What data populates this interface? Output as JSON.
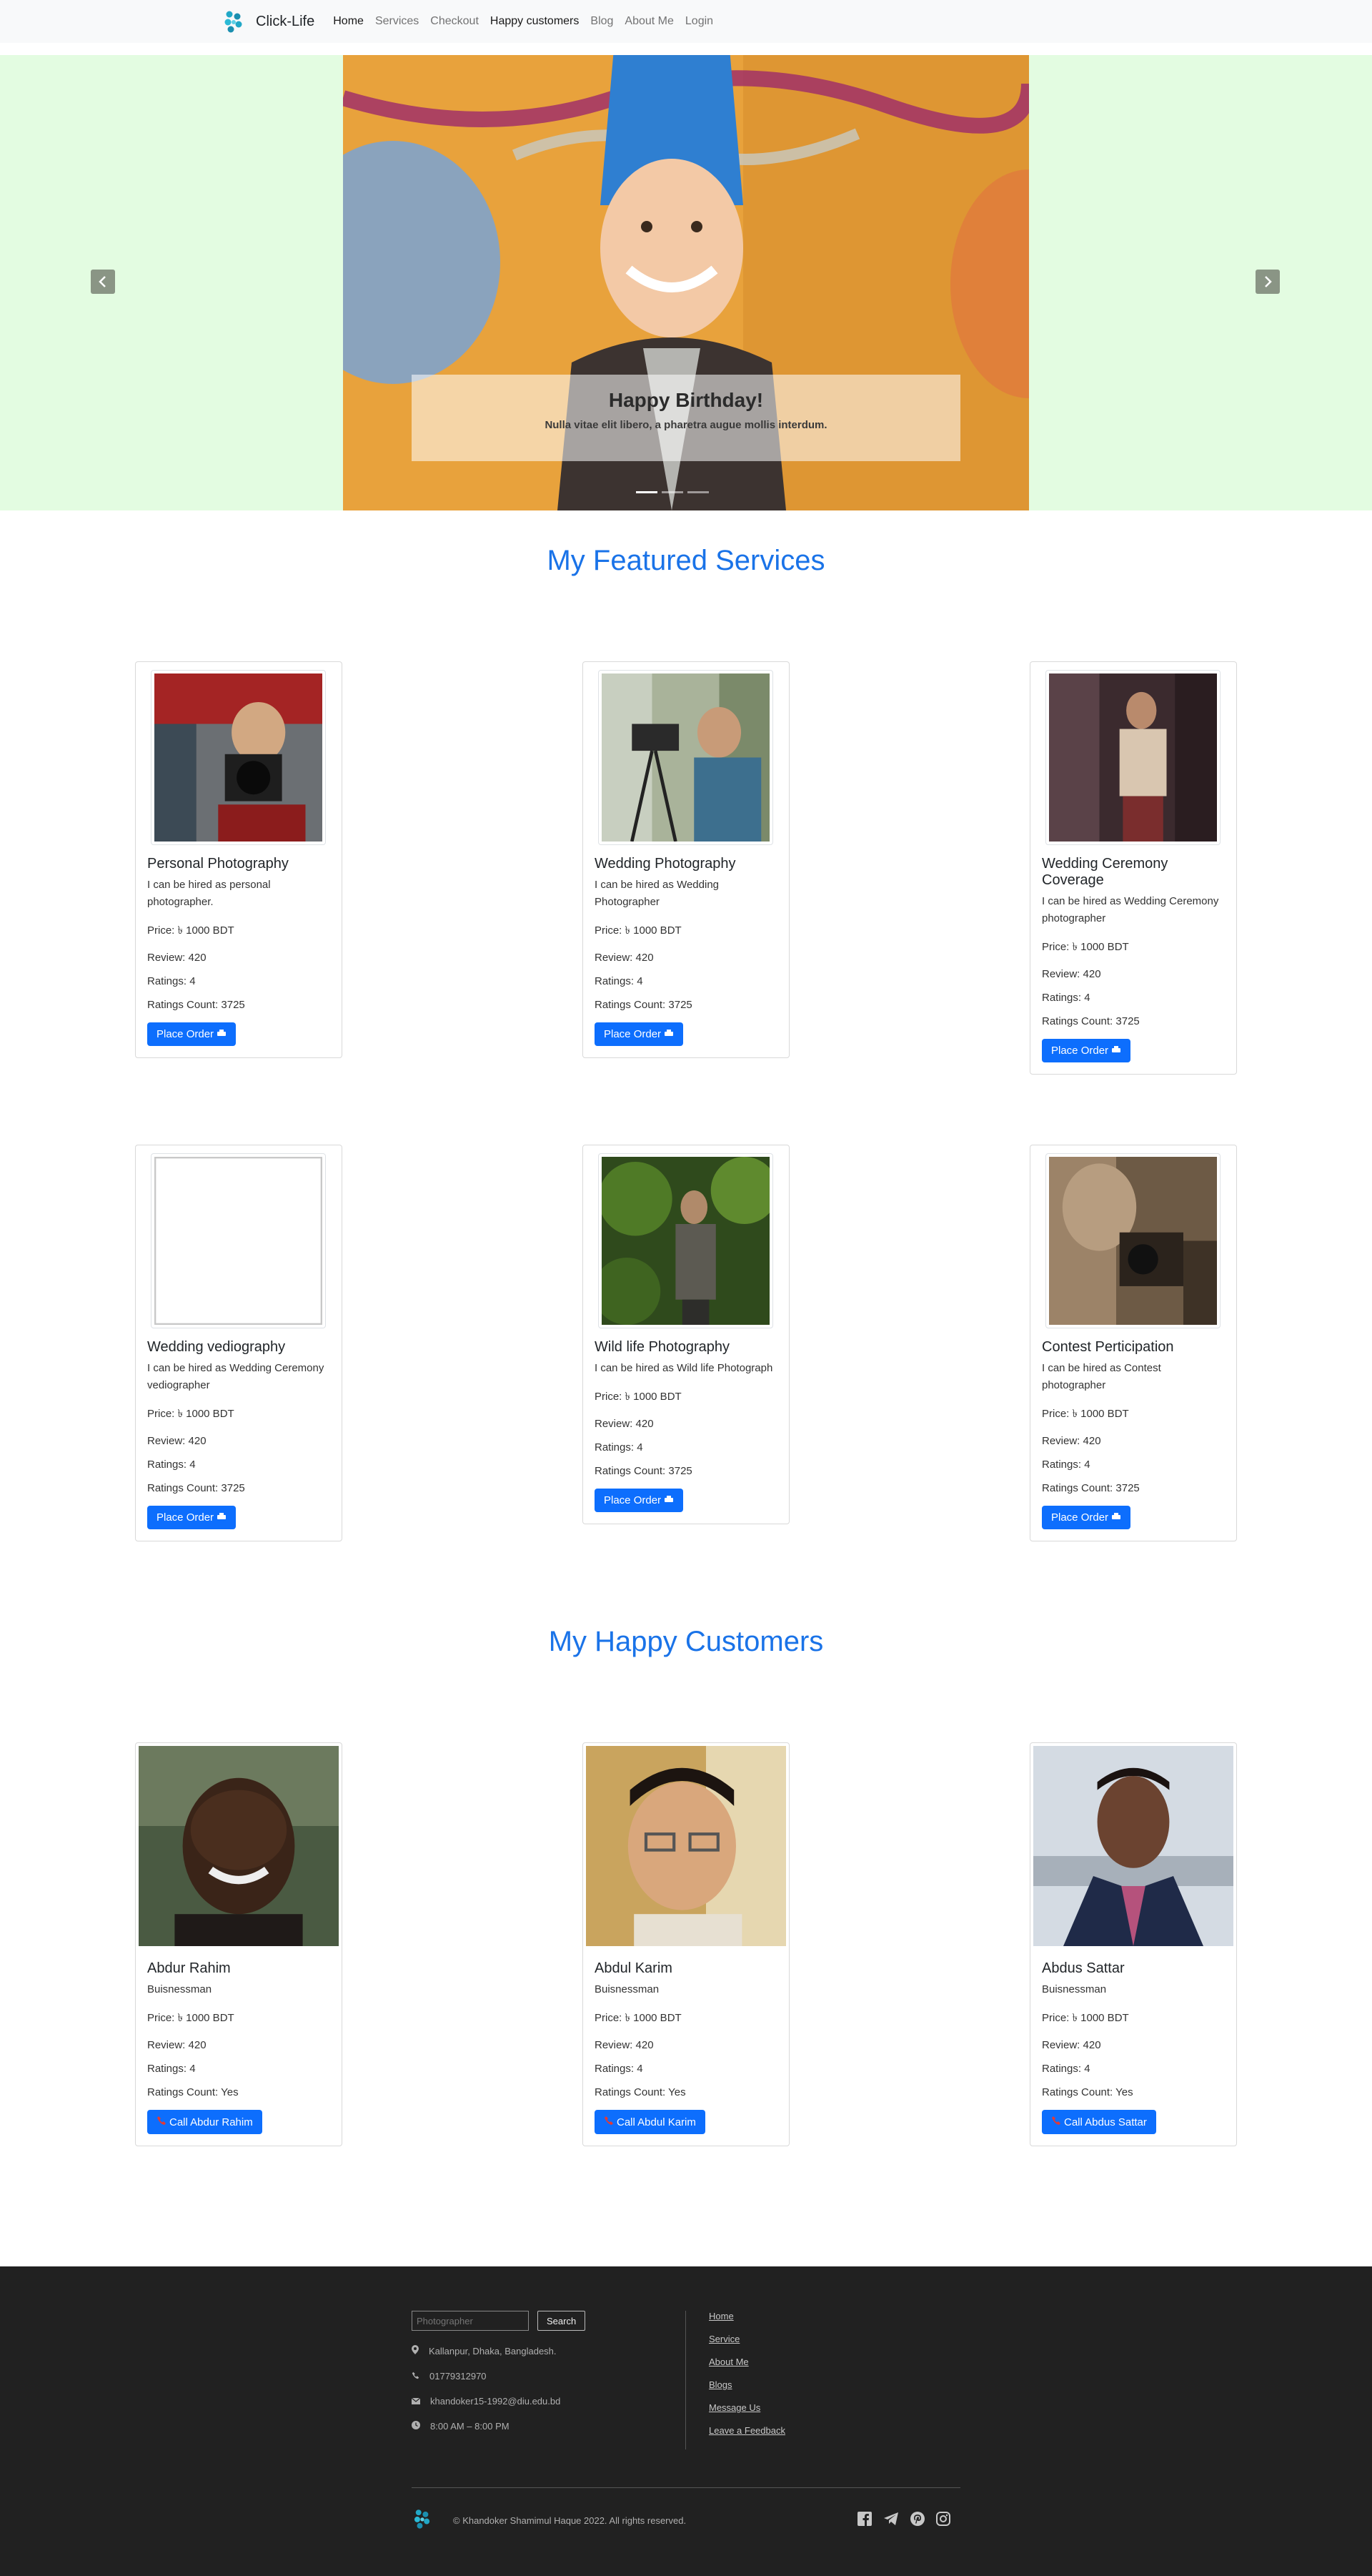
{
  "nav": {
    "brand": "Click-Life",
    "links": [
      "Home",
      "Services",
      "Checkout",
      "Happy customers",
      "Blog",
      "About Me",
      "Login"
    ]
  },
  "hero": {
    "caption_title": "Happy Birthday!",
    "caption_text": "Nulla vitae elit libero, a pharetra augue mollis interdum.",
    "slides": 3,
    "active_slide": 1
  },
  "services": {
    "title": "My Featured Services",
    "button_label": "Place Order",
    "items": [
      {
        "name": "Personal Photography",
        "desc": "I can be hired as personal photographer.",
        "price": "Price: ৳ 1000 BDT",
        "review": "Review: 420",
        "ratings": "Ratings: 4",
        "count": "Ratings Count: 3725"
      },
      {
        "name": "Wedding Photography",
        "desc": "I can be hired as Wedding Photographer",
        "price": "Price: ৳ 1000 BDT",
        "review": "Review: 420",
        "ratings": "Ratings: 4",
        "count": "Ratings Count: 3725"
      },
      {
        "name": "Wedding Ceremony Coverage",
        "desc": "I can be hired as Wedding Ceremony photographer",
        "price": "Price: ৳ 1000 BDT",
        "review": "Review: 420",
        "ratings": "Ratings: 4",
        "count": "Ratings Count: 3725"
      },
      {
        "name": "Wedding vediography",
        "desc": "I can be hired as Wedding Ceremony vediographer",
        "price": "Price: ৳ 1000 BDT",
        "review": "Review: 420",
        "ratings": "Ratings: 4",
        "count": "Ratings Count: 3725"
      },
      {
        "name": "Wild life Photography",
        "desc": "I can be hired as Wild life Photograph",
        "price": "Price: ৳ 1000 BDT",
        "review": "Review: 420",
        "ratings": "Ratings: 4",
        "count": "Ratings Count: 3725"
      },
      {
        "name": "Contest Perticipation",
        "desc": "I can be hired as Contest photographer",
        "price": "Price: ৳ 1000 BDT",
        "review": "Review: 420",
        "ratings": "Ratings: 4",
        "count": "Ratings Count: 3725"
      }
    ]
  },
  "customers": {
    "title": "My Happy Customers",
    "items": [
      {
        "name": "Abdur Rahim",
        "role": "Buisnessman",
        "price": "Price: ৳ 1000 BDT",
        "review": "Review: 420",
        "ratings": "Ratings: 4",
        "count": "Ratings Count: Yes",
        "button": "Call Abdur Rahim"
      },
      {
        "name": "Abdul Karim",
        "role": "Buisnessman",
        "price": "Price: ৳ 1000 BDT",
        "review": "Review: 420",
        "ratings": "Ratings: 4",
        "count": "Ratings Count: Yes",
        "button": "Call Abdul Karim"
      },
      {
        "name": "Abdus Sattar",
        "role": "Buisnessman",
        "price": "Price: ৳ 1000 BDT",
        "review": "Review: 420",
        "ratings": "Ratings: 4",
        "count": "Ratings Count: Yes",
        "button": "Call Abdus Sattar"
      }
    ]
  },
  "footer": {
    "search_placeholder": "Photographer",
    "search_button": "Search",
    "address": "Kallanpur, Dhaka, Bangladesh.",
    "phone": "01779312970",
    "email": "khandoker15-1992@diu.edu.bd",
    "hours": "8:00 AM – 8:00 PM",
    "links": [
      "Home",
      "Service",
      "About Me",
      "Blogs",
      "Message Us",
      "Leave a Feedback"
    ],
    "copyright": "© Khandoker Shamimul Haque 2022. All rights reserved.",
    "socials": [
      "facebook-icon",
      "telegram-icon",
      "pinterest-icon",
      "instagram-icon"
    ]
  },
  "colors": {
    "accent": "#0d6efd",
    "heading": "#1a73e8",
    "hero_bg": "#e3fce1",
    "footer_bg": "#212121"
  }
}
